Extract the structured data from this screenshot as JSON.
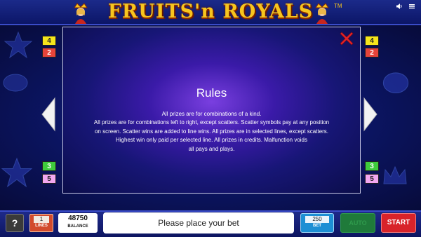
{
  "game": {
    "logo_text": "FRUITS'n ROYALS",
    "logo_tm": "TM"
  },
  "top_icons": [
    "speaker-icon",
    "menu-icon"
  ],
  "line_badges": {
    "left": [
      "4",
      "2",
      "3",
      "5"
    ],
    "right": [
      "4",
      "2",
      "3",
      "5"
    ]
  },
  "rules_panel": {
    "title": "Rules",
    "lines": [
      "All prizes are for combinations of a kind.",
      "All prizes are for combinations left to right, except scatters. Scatter symbols pay at any position",
      "on screen. Scatter wins are added to line wins. All prizes are in selected lines, except scatters.",
      "Highest win only paid per selected line. All prizes in credits. Malfunction voids",
      "all pays and plays."
    ]
  },
  "bottom_bar": {
    "help_label": "?",
    "lines_value": "1",
    "lines_label": "LINES",
    "balance_value": "48750",
    "balance_label": "BALANCE",
    "message": "Please place your bet",
    "bet_value": "250",
    "bet_label": "BET",
    "auto_label": "AUTO",
    "start_label": "START"
  },
  "colors": {
    "start": "#d8232a",
    "auto": "#1f7a3a",
    "bet": "#1d8fd4",
    "lines": "#d24a2c",
    "logo": "#f7c51e"
  }
}
